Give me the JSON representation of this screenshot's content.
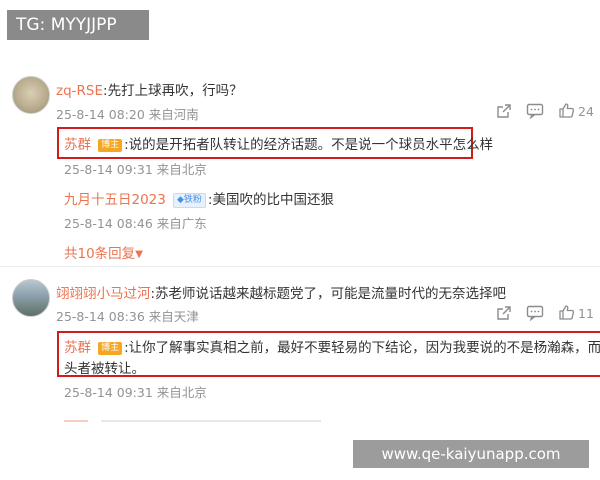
{
  "watermark_top": "TG: MYYJJPP",
  "watermark_bottom": "www.qe-kaiyunapp.com",
  "comment1": {
    "user": "zq-RSE",
    "text": ":先打上球再吹，行吗？",
    "time": "25-8-14 08:20",
    "location": "来自河南",
    "likes": "24",
    "replies": [
      {
        "user": "苏群",
        "badge": "博主",
        "text": ":说的是开拓者队转让的经济话题。不是说一个球员水平怎么样",
        "time": "25-8-14 09:31",
        "location": "来自北京"
      },
      {
        "user": "九月十五日2023",
        "badge": "铁粉",
        "text": ":美国吹的比中国还狠",
        "time": "25-8-14 08:46",
        "location": "来自广东"
      }
    ],
    "expand_label": "共10条回复"
  },
  "comment2": {
    "user": "翊翊翊小马过河",
    "text": ":苏老师说话越来越标题党了，可能是流量时代的无奈选择吧",
    "time": "25-8-14 08:36",
    "location": "来自天津",
    "likes": "11",
    "replies": [
      {
        "user": "苏群",
        "badge": "博主",
        "text_line1": ":让你了解事实真相之前，最好不要轻易的下结论，因为我要说的不是杨瀚森，而是开",
        "text_line2": "头者被转让。",
        "time": "25-8-14 09:31",
        "location": "来自北京"
      }
    ]
  },
  "icons": {
    "share": "share-icon",
    "comment": "comment-icon",
    "like": "thumbs-up-icon",
    "expand": "caret-down-icon"
  },
  "colors": {
    "username": "#eb7350",
    "highlight_box": "#d21c1c",
    "badge_bozhu": "#f5a623"
  }
}
